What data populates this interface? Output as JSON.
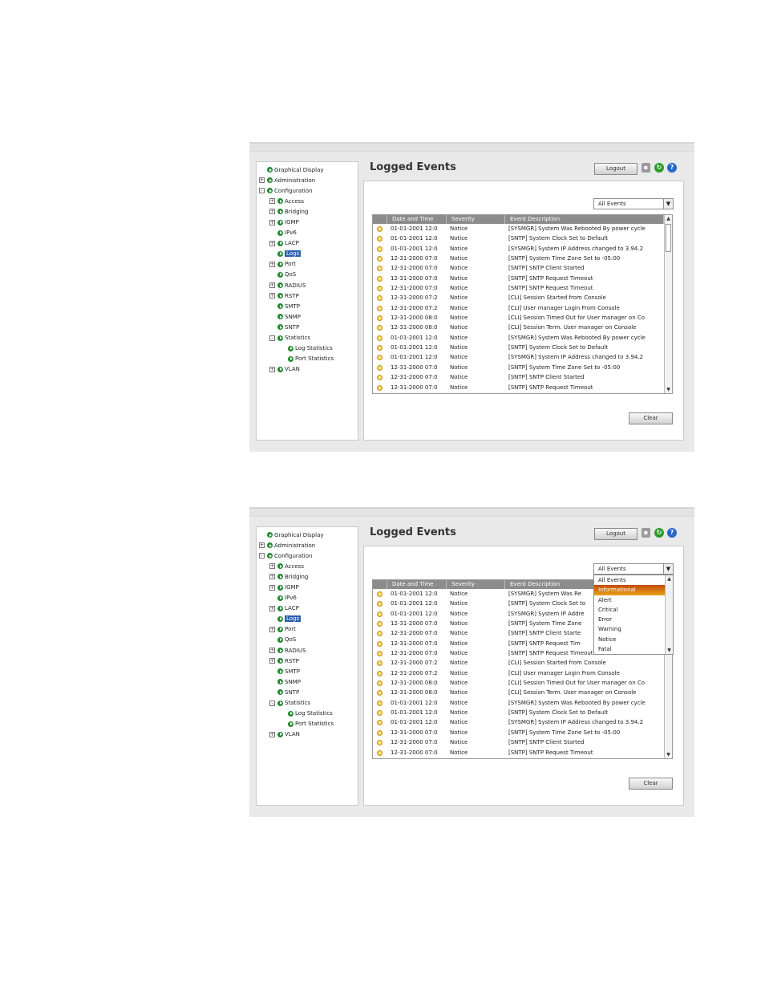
{
  "screens": [
    {
      "tree": [
        {
          "label": "Graphical Display",
          "level": 0,
          "expander": "none",
          "selected": false
        },
        {
          "label": "Administration",
          "level": 0,
          "expander": "+",
          "selected": false
        },
        {
          "label": "Configuration",
          "level": 0,
          "expander": "-",
          "selected": false
        },
        {
          "label": "Access",
          "level": 1,
          "expander": "+",
          "selected": false
        },
        {
          "label": "Bridging",
          "level": 1,
          "expander": "+",
          "selected": false
        },
        {
          "label": "IGMP",
          "level": 1,
          "expander": "+",
          "selected": false
        },
        {
          "label": "IPv6",
          "level": 1,
          "expander": "none",
          "selected": false
        },
        {
          "label": "LACP",
          "level": 1,
          "expander": "+",
          "selected": false
        },
        {
          "label": "Logs",
          "level": 1,
          "expander": "none",
          "selected": true
        },
        {
          "label": "Port",
          "level": 1,
          "expander": "+",
          "selected": false
        },
        {
          "label": "QoS",
          "level": 1,
          "expander": "none",
          "selected": false
        },
        {
          "label": "RADIUS",
          "level": 1,
          "expander": "+",
          "selected": false
        },
        {
          "label": "RSTP",
          "level": 1,
          "expander": "+",
          "selected": false
        },
        {
          "label": "SMTP",
          "level": 1,
          "expander": "none",
          "selected": false
        },
        {
          "label": "SNMP",
          "level": 1,
          "expander": "none",
          "selected": false
        },
        {
          "label": "SNTP",
          "level": 1,
          "expander": "none",
          "selected": false
        },
        {
          "label": "Statistics",
          "level": 1,
          "expander": "-",
          "selected": false
        },
        {
          "label": "Log Statistics",
          "level": 2,
          "expander": "none",
          "selected": false
        },
        {
          "label": "Port Statistics",
          "level": 2,
          "expander": "none",
          "selected": false
        },
        {
          "label": "VLAN",
          "level": 1,
          "expander": "+",
          "selected": false
        }
      ],
      "title": "Logged Events",
      "logout_label": "Logout",
      "filter_value": "All Events",
      "columns": [
        "Date and Time",
        "Severity",
        "Event Description"
      ],
      "rows": [
        {
          "date": "01-01-2001 12:0",
          "severity": "Notice",
          "desc": "[SYSMGR] System Was Rebooted By power cycle"
        },
        {
          "date": "01-01-2001 12:0",
          "severity": "Notice",
          "desc": "[SNTP] System Clock Set to Default"
        },
        {
          "date": "01-01-2001 12:0",
          "severity": "Notice",
          "desc": "[SYSMGR] System IP Address changed to 3.94.2"
        },
        {
          "date": "12-31-2000 07:0",
          "severity": "Notice",
          "desc": "[SNTP] System Time Zone Set to -05:00"
        },
        {
          "date": "12-31-2000 07:0",
          "severity": "Notice",
          "desc": "[SNTP] SNTP Client Started"
        },
        {
          "date": "12-31-2000 07:0",
          "severity": "Notice",
          "desc": "[SNTP] SNTP Request Timeout"
        },
        {
          "date": "12-31-2000 07:0",
          "severity": "Notice",
          "desc": "[SNTP] SNTP Request Timeout"
        },
        {
          "date": "12-31-2000 07:2",
          "severity": "Notice",
          "desc": "[CLI] Session Started from Console"
        },
        {
          "date": "12-31-2000 07:2",
          "severity": "Notice",
          "desc": "[CLI] User manager Login From Console"
        },
        {
          "date": "12-31-2000 08:0",
          "severity": "Notice",
          "desc": "[CLI] Session Timed Out for User manager on Co"
        },
        {
          "date": "12-31-2000 08:0",
          "severity": "Notice",
          "desc": "[CLI] Session Term. User manager on Console"
        },
        {
          "date": "01-01-2001 12:0",
          "severity": "Notice",
          "desc": "[SYSMGR] System Was Rebooted By power cycle"
        },
        {
          "date": "01-01-2001 12:0",
          "severity": "Notice",
          "desc": "[SNTP] System Clock Set to Default"
        },
        {
          "date": "01-01-2001 12:0",
          "severity": "Notice",
          "desc": "[SYSMGR] System IP Address changed to 3.94.2"
        },
        {
          "date": "12-31-2000 07:0",
          "severity": "Notice",
          "desc": "[SNTP] System Time Zone Set to -05:00"
        },
        {
          "date": "12-31-2000 07:0",
          "severity": "Notice",
          "desc": "[SNTP] SNTP Client Started"
        },
        {
          "date": "12-31-2000 07:0",
          "severity": "Notice",
          "desc": "[SNTP] SNTP Request Timeout"
        }
      ],
      "clear_label": "Clear"
    },
    {
      "tree": [
        {
          "label": "Graphical Display",
          "level": 0,
          "expander": "none",
          "selected": false
        },
        {
          "label": "Administration",
          "level": 0,
          "expander": "+",
          "selected": false
        },
        {
          "label": "Configuration",
          "level": 0,
          "expander": "-",
          "selected": false
        },
        {
          "label": "Access",
          "level": 1,
          "expander": "+",
          "selected": false
        },
        {
          "label": "Bridging",
          "level": 1,
          "expander": "+",
          "selected": false
        },
        {
          "label": "IGMP",
          "level": 1,
          "expander": "+",
          "selected": false
        },
        {
          "label": "IPv6",
          "level": 1,
          "expander": "none",
          "selected": false
        },
        {
          "label": "LACP",
          "level": 1,
          "expander": "+",
          "selected": false
        },
        {
          "label": "Logs",
          "level": 1,
          "expander": "none",
          "selected": true
        },
        {
          "label": "Port",
          "level": 1,
          "expander": "+",
          "selected": false
        },
        {
          "label": "QoS",
          "level": 1,
          "expander": "none",
          "selected": false
        },
        {
          "label": "RADIUS",
          "level": 1,
          "expander": "+",
          "selected": false
        },
        {
          "label": "RSTP",
          "level": 1,
          "expander": "+",
          "selected": false
        },
        {
          "label": "SMTP",
          "level": 1,
          "expander": "none",
          "selected": false
        },
        {
          "label": "SNMP",
          "level": 1,
          "expander": "none",
          "selected": false
        },
        {
          "label": "SNTP",
          "level": 1,
          "expander": "none",
          "selected": false
        },
        {
          "label": "Statistics",
          "level": 1,
          "expander": "-",
          "selected": false
        },
        {
          "label": "Log Statistics",
          "level": 2,
          "expander": "none",
          "selected": false
        },
        {
          "label": "Port Statistics",
          "level": 2,
          "expander": "none",
          "selected": false
        },
        {
          "label": "VLAN",
          "level": 1,
          "expander": "+",
          "selected": false
        }
      ],
      "title": "Logged Events",
      "logout_label": "Logout",
      "filter_value": "All Events",
      "dropdown_open": true,
      "dropdown_options": [
        "All Events",
        "Informational",
        "Alert",
        "Critical",
        "Error",
        "Warning",
        "Notice",
        "Fatal"
      ],
      "dropdown_highlighted": "Informational",
      "columns": [
        "Date and Time",
        "Severity",
        "Event Description"
      ],
      "rows": [
        {
          "date": "01-01-2001 12:0",
          "severity": "Notice",
          "desc": "[SYSMGR] System Was Re"
        },
        {
          "date": "01-01-2001 12:0",
          "severity": "Notice",
          "desc": "[SNTP] System Clock Set to"
        },
        {
          "date": "01-01-2001 12:0",
          "severity": "Notice",
          "desc": "[SYSMGR] System IP Addre"
        },
        {
          "date": "12-31-2000 07:0",
          "severity": "Notice",
          "desc": "[SNTP] System Time Zone"
        },
        {
          "date": "12-31-2000 07:0",
          "severity": "Notice",
          "desc": "[SNTP] SNTP Client Starte"
        },
        {
          "date": "12-31-2000 07:0",
          "severity": "Notice",
          "desc": "[SNTP] SNTP Request Tim"
        },
        {
          "date": "12-31-2000 07:0",
          "severity": "Notice",
          "desc": "[SNTP] SNTP Request Timeout"
        },
        {
          "date": "12-31-2000 07:2",
          "severity": "Notice",
          "desc": "[CLI] Session Started from Console"
        },
        {
          "date": "12-31-2000 07:2",
          "severity": "Notice",
          "desc": "[CLI] User manager Login From Console"
        },
        {
          "date": "12-31-2000 08:0",
          "severity": "Notice",
          "desc": "[CLI] Session Timed Out for User manager on Co"
        },
        {
          "date": "12-31-2000 08:0",
          "severity": "Notice",
          "desc": "[CLI] Session Term. User manager on Console"
        },
        {
          "date": "01-01-2001 12:0",
          "severity": "Notice",
          "desc": "[SYSMGR] System Was Rebooted By power cycle"
        },
        {
          "date": "01-01-2001 12:0",
          "severity": "Notice",
          "desc": "[SNTP] System Clock Set to Default"
        },
        {
          "date": "01-01-2001 12:0",
          "severity": "Notice",
          "desc": "[SYSMGR] System IP Address changed to 3.94.2"
        },
        {
          "date": "12-31-2000 07:0",
          "severity": "Notice",
          "desc": "[SNTP] System Time Zone Set to -05:00"
        },
        {
          "date": "12-31-2000 07:0",
          "severity": "Notice",
          "desc": "[SNTP] SNTP Client Started"
        },
        {
          "date": "12-31-2000 07:0",
          "severity": "Notice",
          "desc": "[SNTP] SNTP Request Timeout"
        }
      ],
      "clear_label": "Clear"
    }
  ],
  "icons": {
    "save": "save-icon",
    "refresh": "refresh-icon",
    "help": "help-icon",
    "tree_node": "green-arrow-icon",
    "row": "lightbulb-icon"
  },
  "colors": {
    "selected_node": "#2a5db0",
    "header": "#8c8c8c",
    "highlight_option": "#d46a10",
    "node_dot": "#1d8a2c"
  }
}
